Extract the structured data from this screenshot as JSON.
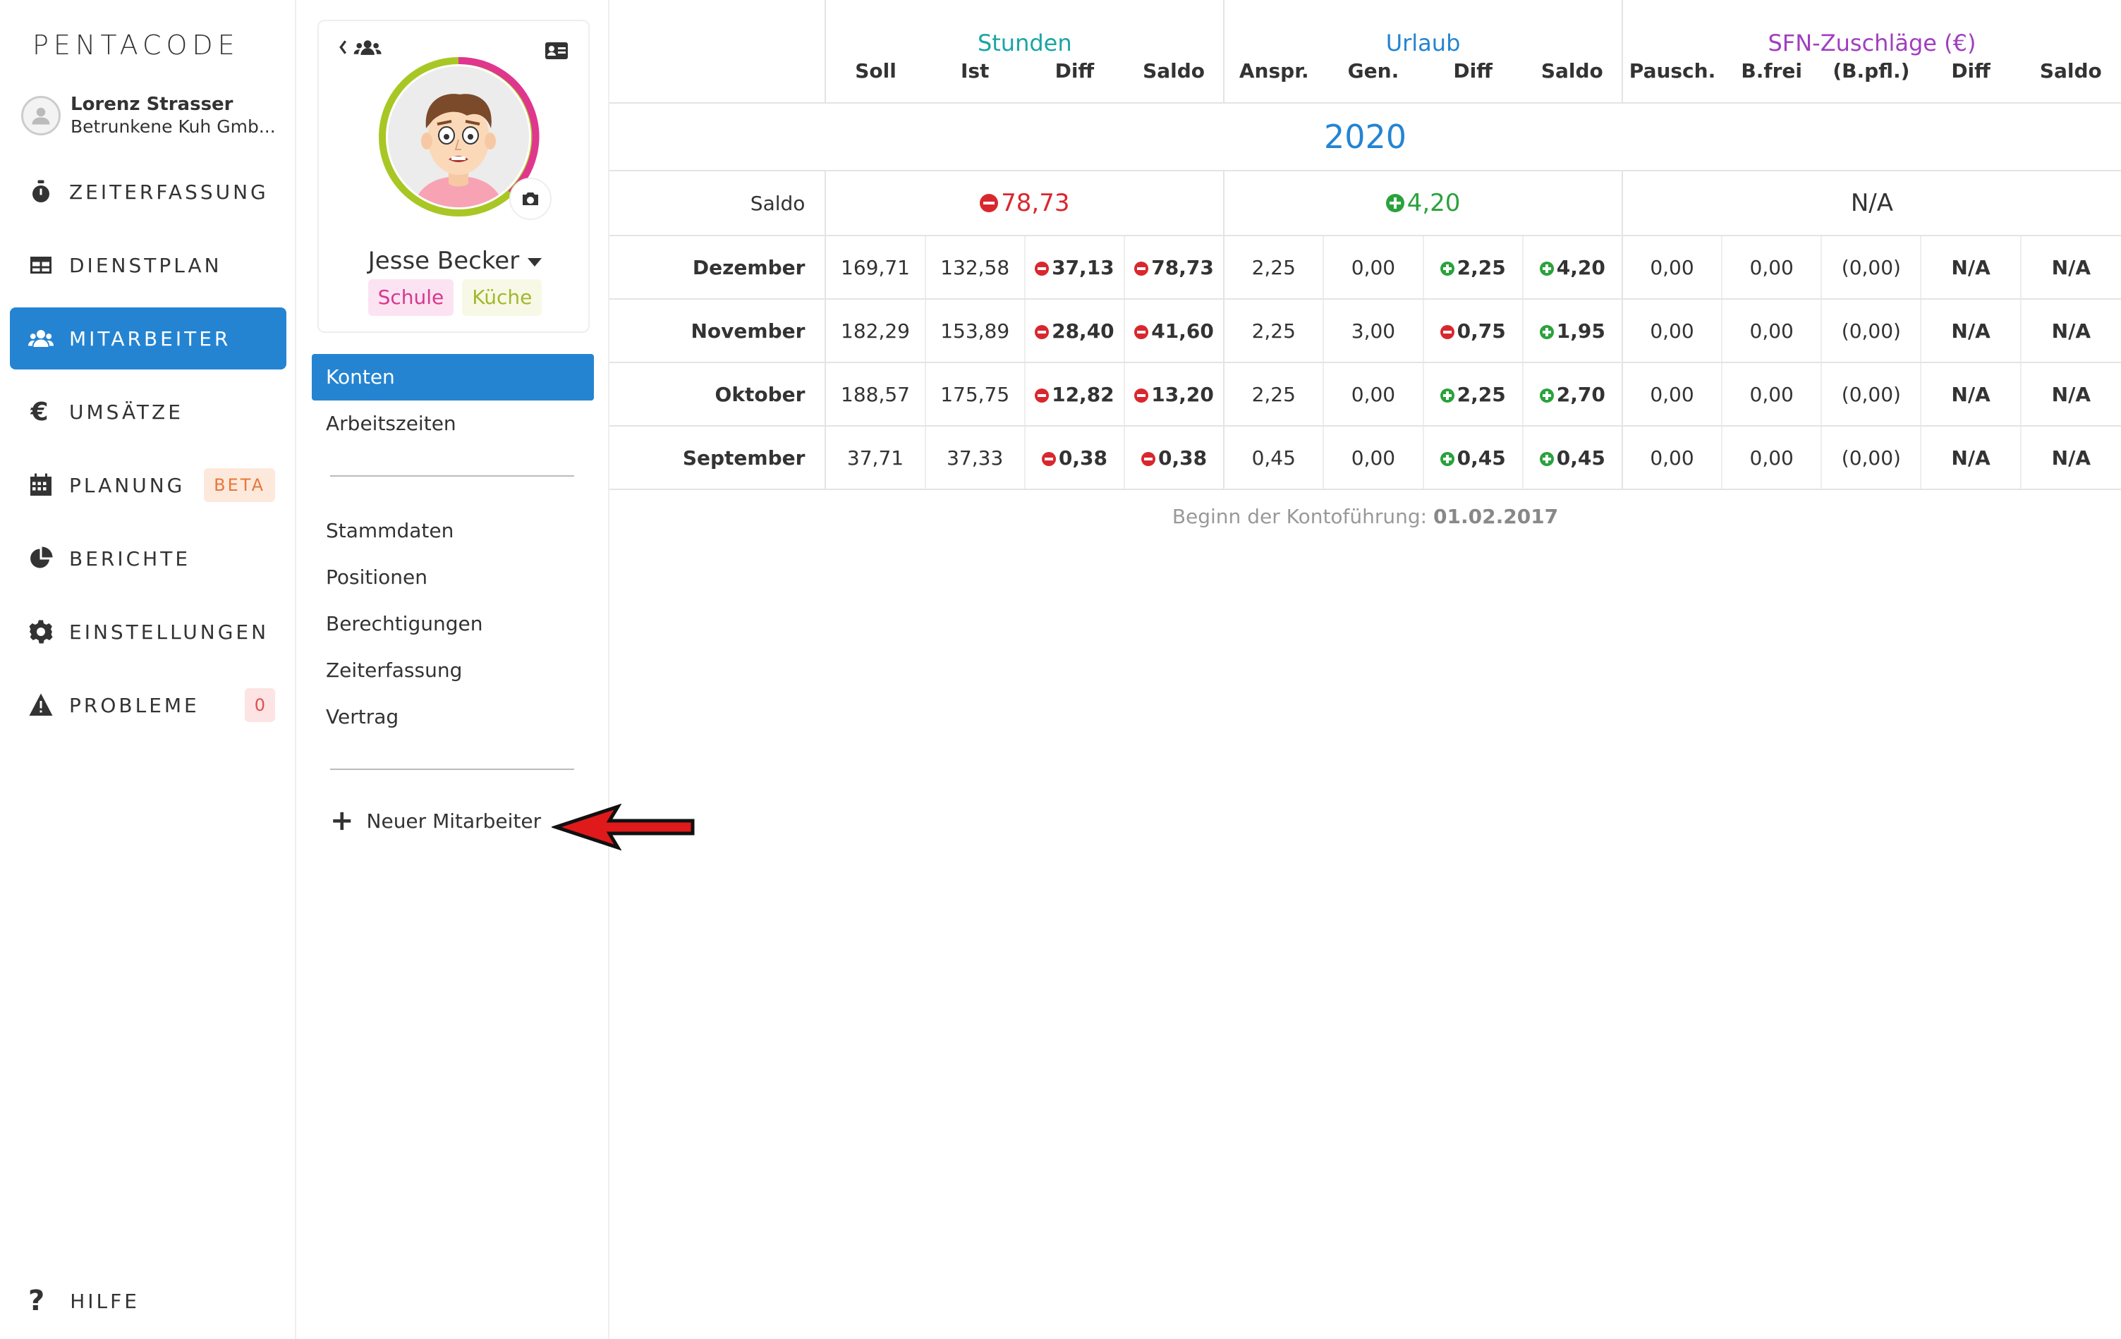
{
  "app": {
    "logo": "PENTACODE"
  },
  "user": {
    "name": "Lorenz Strasser",
    "company": "Betrunkene Kuh Gmb..."
  },
  "nav": [
    {
      "label": "ZEITERFASSUNG",
      "icon": "stopwatch-icon"
    },
    {
      "label": "DIENSTPLAN",
      "icon": "table-icon"
    },
    {
      "label": "MITARBEITER",
      "icon": "users-icon",
      "active": true
    },
    {
      "label": "UMSÄTZE",
      "icon": "euro-icon"
    },
    {
      "label": "PLANUNG",
      "icon": "calendar-icon",
      "badge": "BETA"
    },
    {
      "label": "BERICHTE",
      "icon": "pie-chart-icon"
    },
    {
      "label": "EINSTELLUNGEN",
      "icon": "gear-icon"
    },
    {
      "label": "PROBLEME",
      "icon": "warning-icon",
      "badge": "0"
    }
  ],
  "help": {
    "label": "HILFE"
  },
  "employee": {
    "name": "Jesse Becker",
    "tags": [
      "Schule",
      "Küche"
    ]
  },
  "subnav": {
    "primary": [
      {
        "label": "Konten",
        "active": true
      },
      {
        "label": "Arbeitszeiten"
      }
    ],
    "secondary": [
      {
        "label": "Stammdaten"
      },
      {
        "label": "Positionen"
      },
      {
        "label": "Berechtigungen"
      },
      {
        "label": "Zeiterfassung"
      },
      {
        "label": "Vertrag"
      }
    ],
    "new_employee": "Neuer Mitarbeiter"
  },
  "table": {
    "groups": {
      "stunden": "Stunden",
      "urlaub": "Urlaub",
      "sfn": "SFN-Zuschläge (€)"
    },
    "columns": [
      "Soll",
      "Ist",
      "Diff",
      "Saldo",
      "Anspr.",
      "Gen.",
      "Diff",
      "Saldo",
      "Pausch.",
      "B.frei",
      "(B.pfl.)",
      "Diff",
      "Saldo"
    ],
    "year": "2020",
    "saldo": {
      "label": "Saldo",
      "stunden": "78,73",
      "urlaub": "4,20",
      "sfn": "N/A"
    },
    "rows": [
      {
        "month": "Dezember",
        "soll": "169,71",
        "ist": "132,58",
        "diff": "37,13",
        "saldo": "78,73",
        "anspr": "2,25",
        "gen": "0,00",
        "u_diff": "2,25",
        "u_saldo": "4,20",
        "pausch": "0,00",
        "bfrei": "0,00",
        "bpfl": "(0,00)",
        "s_diff": "N/A",
        "s_saldo": "N/A"
      },
      {
        "month": "November",
        "soll": "182,29",
        "ist": "153,89",
        "diff": "28,40",
        "saldo": "41,60",
        "anspr": "2,25",
        "gen": "3,00",
        "u_diff": "0,75",
        "u_saldo": "1,95",
        "pausch": "0,00",
        "bfrei": "0,00",
        "bpfl": "(0,00)",
        "s_diff": "N/A",
        "s_saldo": "N/A"
      },
      {
        "month": "Oktober",
        "soll": "188,57",
        "ist": "175,75",
        "diff": "12,82",
        "saldo": "13,20",
        "anspr": "2,25",
        "gen": "0,00",
        "u_diff": "2,25",
        "u_saldo": "2,70",
        "pausch": "0,00",
        "bfrei": "0,00",
        "bpfl": "(0,00)",
        "s_diff": "N/A",
        "s_saldo": "N/A"
      },
      {
        "month": "September",
        "soll": "37,71",
        "ist": "37,33",
        "diff": "0,38",
        "saldo": "0,38",
        "anspr": "0,45",
        "gen": "0,00",
        "u_diff": "0,45",
        "u_saldo": "0,45",
        "pausch": "0,00",
        "bfrei": "0,00",
        "bpfl": "(0,00)",
        "s_diff": "N/A",
        "s_saldo": "N/A"
      }
    ],
    "footer_label": "Beginn der Kontoführung:",
    "footer_date": "01.02.2017"
  },
  "colors": {
    "accent": "#2484d2",
    "negative": "#d9272e",
    "positive": "#2aa23c",
    "stunden": "#1aa5a5",
    "sfn": "#a03fbf"
  }
}
